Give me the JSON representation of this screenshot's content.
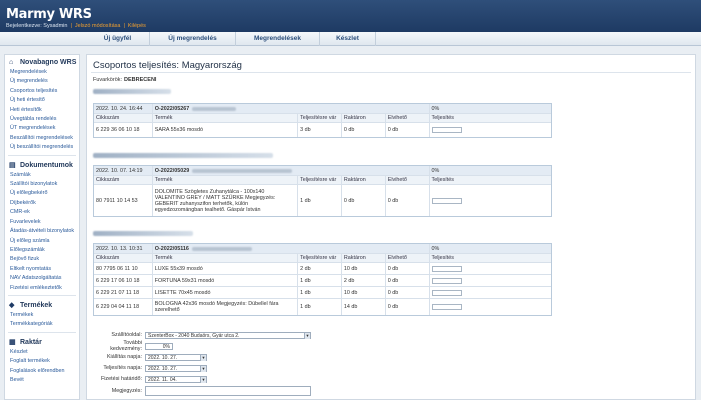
{
  "app": {
    "logo": "Marmy WRS",
    "user_prefix": "Bejelentkezve: Sysadmin",
    "links": [
      "Jelszó módosítása",
      "Kilépés"
    ]
  },
  "nav": [
    "Új ügyfél",
    "Új megrendelés",
    "Megrendelések",
    "Készlet"
  ],
  "sidebar": {
    "sections": [
      {
        "title": "Novabagno WRS",
        "icon": "home-icon",
        "items": [
          "Megrendelések",
          "Új megrendelés",
          "Csoportos teljesítés",
          "Új heti értesítő",
          "Heti értesítők",
          "Üvegtábla rendelés",
          "ÜT megrendelések",
          "Beszállítói megrendelések",
          "Új beszállítói megrendelés"
        ]
      },
      {
        "title": "Dokumentumok",
        "icon": "document-icon",
        "items": [
          "Számlák",
          "Szállítói bizonylatok",
          "Új előlegbekérő",
          "Díjbekérők",
          "CMR-ek",
          "Fuvarlevelek",
          "Átadás-átvételi bizonylatok",
          "Új előleg számla",
          "Előlegszámlák",
          "Bejövő fizuk",
          "Eltkelt nyomtatás",
          "NAV Adatszolgáltatás",
          "Fizetési emlékeztetők"
        ]
      },
      {
        "title": "Termékek",
        "icon": "tag-icon",
        "items": [
          "Termékek",
          "Termékkategóriák"
        ]
      },
      {
        "title": "Raktár",
        "icon": "warehouse-icon",
        "items": [
          "Készlet",
          "Foglalt termékek",
          "Foglalások előrendben",
          "Bevét"
        ]
      }
    ]
  },
  "main": {
    "title": "Csoportos teljesítés: Magyarország",
    "fuvar_label": "Fuvarkörök:",
    "fuvar_value": "DEBRECENI",
    "col_headers": [
      "Cikkszám",
      "Termék",
      "Teljesítésre vár",
      "Raktáron",
      "Elvihető",
      "Teljesítés"
    ],
    "orders": [
      {
        "date": "2022. 10. 24. 16:44",
        "code": "O-2022/05267",
        "pct": "0%",
        "rows": [
          {
            "sku": "6 229 36 06 10 18",
            "product": "SARA 55x36 mosdó",
            "wait": "3 db",
            "stock": "0 db",
            "avail": "0 db"
          }
        ]
      },
      {
        "date": "2022. 10. 07. 14:19",
        "code": "O-2022/05029",
        "pct": "0%",
        "rows": [
          {
            "sku": "80 7911 10 14 53",
            "product": "DOLOMITE Szögletes Zuhanytálca - 100x140 VALENTINO GREY / MATT SZÜRKE Megjegyzés: GEBERIT zuhanyszifon terhetők, külön egyedzozomángban tealhető. Gáspár István",
            "wait": "1 db",
            "stock": "0 db",
            "avail": "0 db"
          }
        ]
      },
      {
        "date": "2022. 10. 13. 10:31",
        "code": "O-2022/05116",
        "pct": "0%",
        "rows": [
          {
            "sku": "80 7795 06 11 10",
            "product": "LUXE 55x39 mosdó",
            "wait": "2 db",
            "stock": "10 db",
            "avail": "0 db"
          },
          {
            "sku": "6 229 17 06 10 18",
            "product": "FORTUNA 59x31 mosdó",
            "wait": "1 db",
            "stock": "2 db",
            "avail": "0 db"
          },
          {
            "sku": "6 229 21 07 11 18",
            "product": "LISETTE 70x45 mosdó",
            "wait": "1 db",
            "stock": "10 db",
            "avail": "0 db"
          },
          {
            "sku": "6 229 04 04 11 18",
            "product": "BOLOGNA 42x36 mosdó Megjegyzés: Dübellel fára szerelhető",
            "wait": "1 db",
            "stock": "14 db",
            "avail": "0 db"
          }
        ]
      }
    ],
    "form": {
      "warehouse_label": "Szállítóoldal:",
      "warehouse_value": "SzenterBox - 2040 Budaörs, Gyár utca 2.",
      "discount_label": "További kedvezmény:",
      "discount_value": "0%",
      "issue_label": "Kiállítás napja:",
      "issue_value": "2022. 10. 27.",
      "perf_label": "Teljesítés napja:",
      "perf_value": "2022. 10. 27.",
      "due_label": "Fizetési határidő:",
      "due_value": "2022. 11. 04.",
      "note_label": "Megjegyzés:"
    }
  }
}
